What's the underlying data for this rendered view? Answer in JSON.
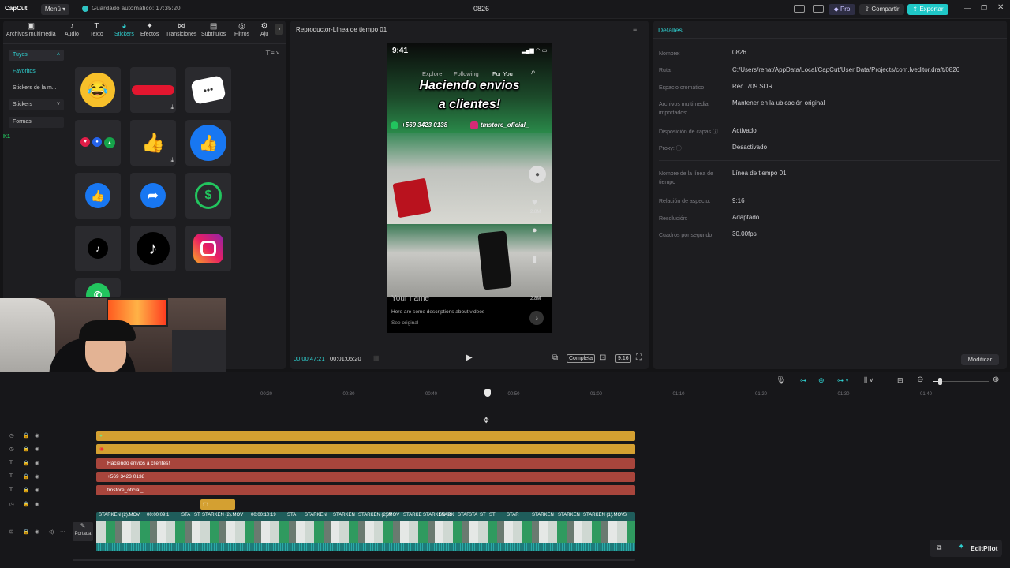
{
  "titlebar": {
    "logo": "CapCut",
    "menu": "Menú ▾",
    "autosave": "Guardado automático: 17:35:20",
    "project": "0826",
    "pro": "Pro",
    "share": "Compartir",
    "export": "Exportar"
  },
  "tools": {
    "tabs": [
      {
        "label": "Archivos multimedia",
        "icon": "media-icon"
      },
      {
        "label": "Audio",
        "icon": "audio-icon"
      },
      {
        "label": "Texto",
        "icon": "text-icon"
      },
      {
        "label": "Stickers",
        "icon": "sticker-icon"
      },
      {
        "label": "Efectos",
        "icon": "effects-icon"
      },
      {
        "label": "Transiciones",
        "icon": "transitions-icon"
      },
      {
        "label": "Subtítulos",
        "icon": "subtitles-icon"
      },
      {
        "label": "Filtros",
        "icon": "filters-icon"
      },
      {
        "label": "Aju",
        "icon": "adjust-icon"
      }
    ]
  },
  "sidebar": {
    "items": [
      "Tuyos",
      "Favoritos",
      "Stickers de la m...",
      "Stickers",
      "Formas"
    ]
  },
  "player": {
    "title": "Reproductor-Línea de tiempo 01",
    "current_time": "00:00:47:21",
    "total_time": "00:01:05:20",
    "complete": "Completa",
    "ratio": "9:16",
    "phone": {
      "time": "9:41",
      "nav": [
        "Explore",
        "Following",
        "For You"
      ],
      "headline_1": "Haciendo envios",
      "headline_2": "a clientes!",
      "phone_number": "+569 3423 0138",
      "instagram": "tmstore_oficial_",
      "likes": "2.8M",
      "comments": "2.8M",
      "username": "Your name",
      "description": "Here are some descriptions about videos",
      "see_original": "See original"
    }
  },
  "details": {
    "title": "Detalles",
    "rows": [
      {
        "label": "Nombre:",
        "value": "0826"
      },
      {
        "label": "Ruta:",
        "value": "C:/Users/renat/AppData/Local/CapCut/User Data/Projects/com.lveditor.draft/0826"
      },
      {
        "label": "Espacio cromático",
        "value": "Rec. 709 SDR"
      },
      {
        "label": "Archivos multimedia importados:",
        "value": "Mantener en la ubicación original"
      },
      {
        "label": "Disposición de capas ⓘ",
        "value": "Activado"
      },
      {
        "label": "Proxy: ⓘ",
        "value": "Desactivado"
      },
      {
        "label": "Nombre de la línea de tiempo",
        "value": "Línea de tiempo 01"
      },
      {
        "label": "Relación de aspecto:",
        "value": "9:16"
      },
      {
        "label": "Resolución:",
        "value": "Adaptado"
      },
      {
        "label": "Cuadros por segundo:",
        "value": "30.00fps"
      }
    ],
    "modify": "Modificar"
  },
  "timeline": {
    "ruler": [
      "00:20",
      "00:30",
      "00:40",
      "00:50",
      "01:00",
      "01:10",
      "01:20",
      "01:30",
      "01:40"
    ],
    "text_clips": [
      "Haciendo envios a clientes!",
      "+569 3423 0138",
      "tmstore_oficial_"
    ],
    "cover_label": "Portada",
    "video_clips": [
      "STARKEN (2).MOV",
      "00:00:09:1",
      "STA",
      "ST",
      "STARKEN (2).MOV",
      "00:00:10:19",
      "STA",
      "STARKEN",
      "STARKEN",
      "STARKEN (2).MOV",
      "ST",
      "STARKE",
      "STARKEN (2",
      "STARK",
      "STAR",
      "STA",
      "ST",
      "ST",
      "STAR",
      "STARKEN",
      "STARKEN",
      "STARKEN (1).MOV",
      "S"
    ],
    "editpilot": "EditPilot"
  },
  "colors": {
    "accent": "#22d3ee",
    "export": "#1fc8c8",
    "gold_track": "#d4a031",
    "red_track": "#a8453c",
    "video_track": "#1f8f8c"
  }
}
